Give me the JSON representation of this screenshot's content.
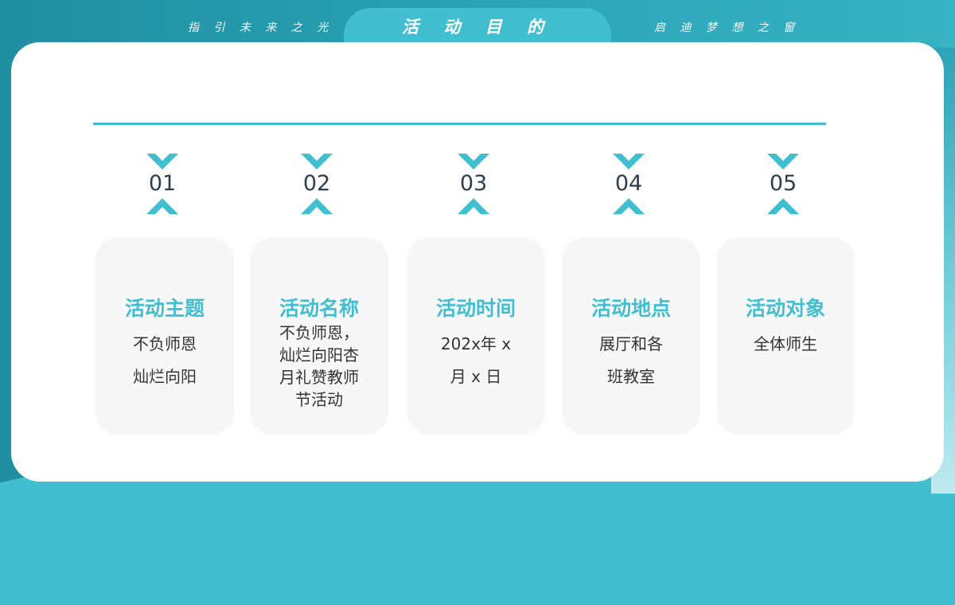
{
  "header": {
    "tagline_left": "指 引 未 来 之 光",
    "title": "活 动 目 的",
    "tagline_right": "启 迪 梦 想 之 窗"
  },
  "colors": {
    "accent": "#41bfd0",
    "background": "#2aa3b6",
    "text": "#333333"
  },
  "steps": [
    {
      "number": "01",
      "title": "活动主题",
      "lines": [
        "不负师恩",
        "灿烂向阳"
      ]
    },
    {
      "number": "02",
      "title": "活动名称",
      "lines": [
        "不负师恩，",
        "灿烂向阳杏",
        "月礼赞教师",
        "节活动"
      ]
    },
    {
      "number": "03",
      "title": "活动时间",
      "lines": [
        "202x年 x",
        "月 x 日"
      ]
    },
    {
      "number": "04",
      "title": "活动地点",
      "lines": [
        "展厅和各",
        "班教室"
      ]
    },
    {
      "number": "05",
      "title": "活动对象",
      "lines": [
        "全体师生"
      ]
    }
  ]
}
